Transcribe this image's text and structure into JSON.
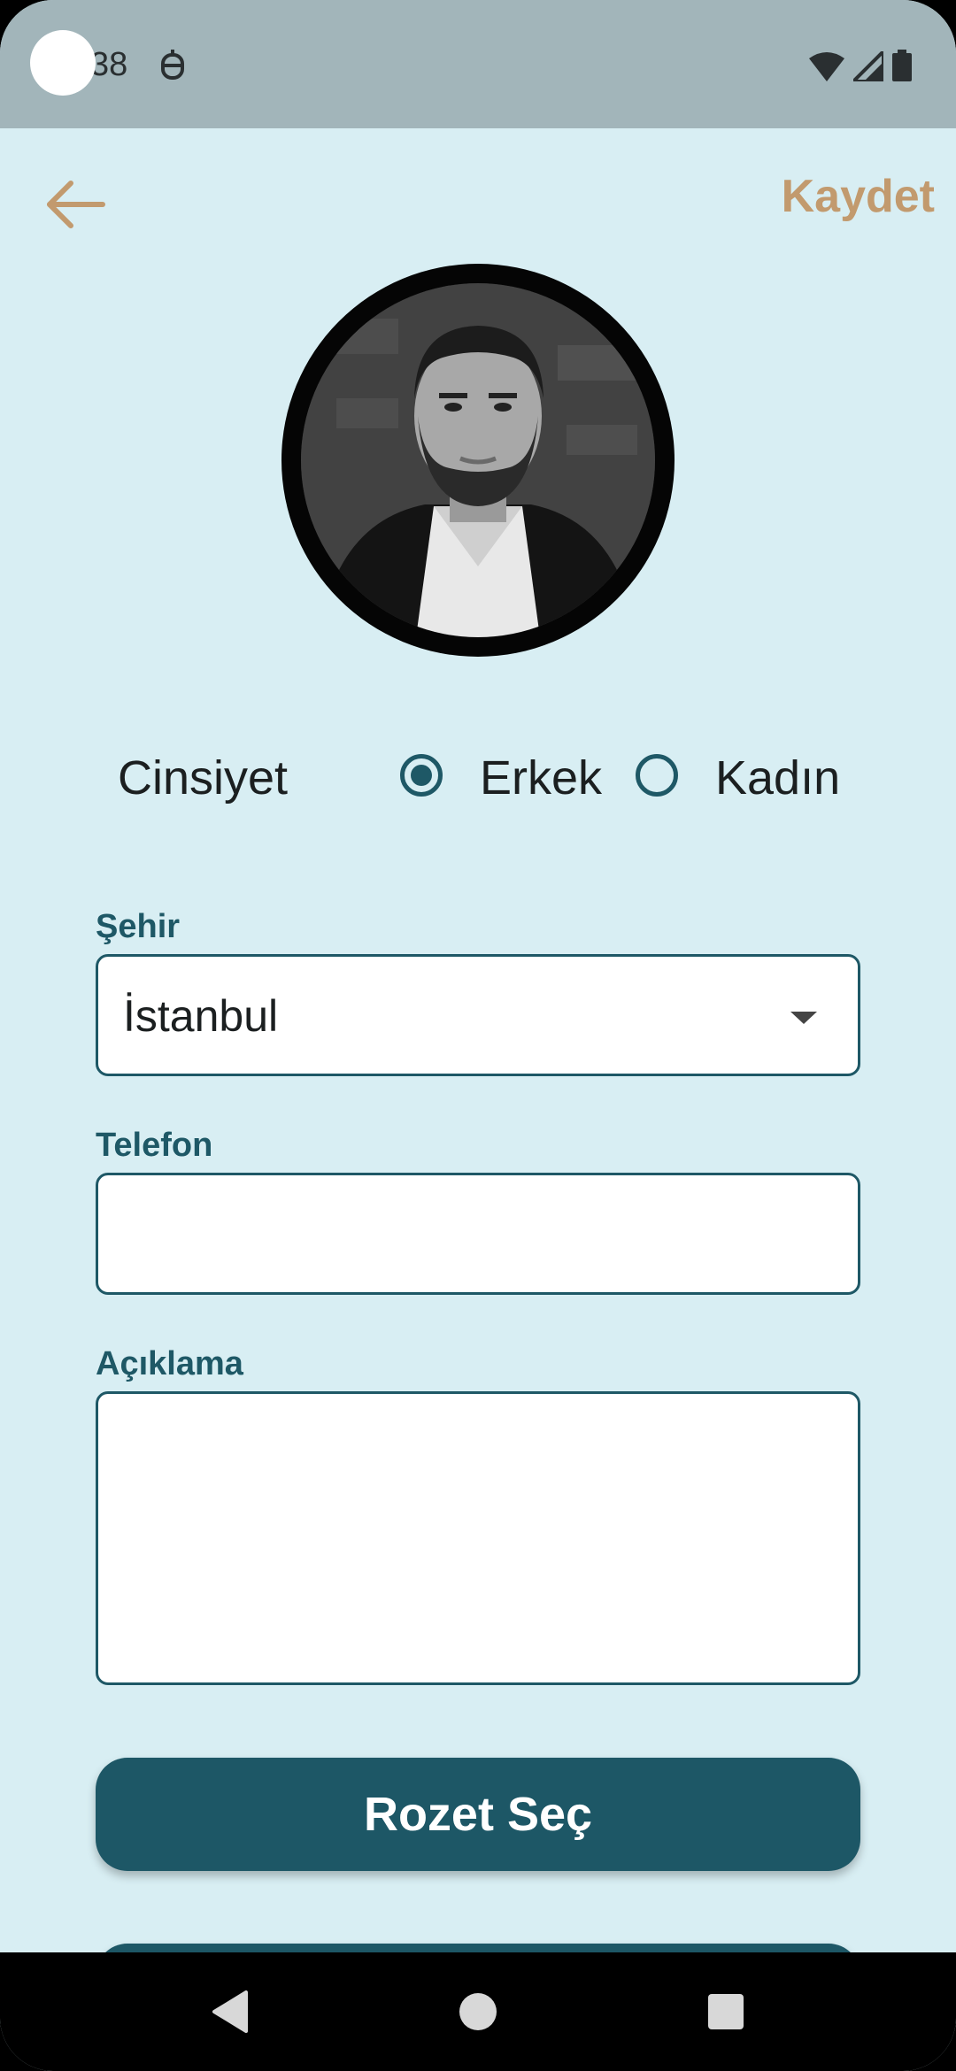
{
  "status_bar": {
    "time": "38",
    "icons": [
      "assistant-icon",
      "wifi-icon",
      "signal-icon",
      "battery-icon"
    ]
  },
  "app_bar": {
    "back_icon": "arrow-left-icon",
    "save_label": "Kaydet",
    "accent_color": "#c29a6e"
  },
  "profile": {
    "avatar": "profile-photo"
  },
  "gender": {
    "label": "Cinsiyet",
    "options": [
      "Erkek",
      "Kadın"
    ],
    "selected": "Erkek"
  },
  "city": {
    "label": "Şehir",
    "value": "İstanbul"
  },
  "phone": {
    "label": "Telefon",
    "value": ""
  },
  "description": {
    "label": "Açıklama",
    "value": ""
  },
  "buttons": {
    "badge_label": "Rozet Seç",
    "primary_color": "#1d5766"
  },
  "nav": {
    "items": [
      "back-triangle-icon",
      "home-circle-icon",
      "recents-square-icon"
    ]
  }
}
